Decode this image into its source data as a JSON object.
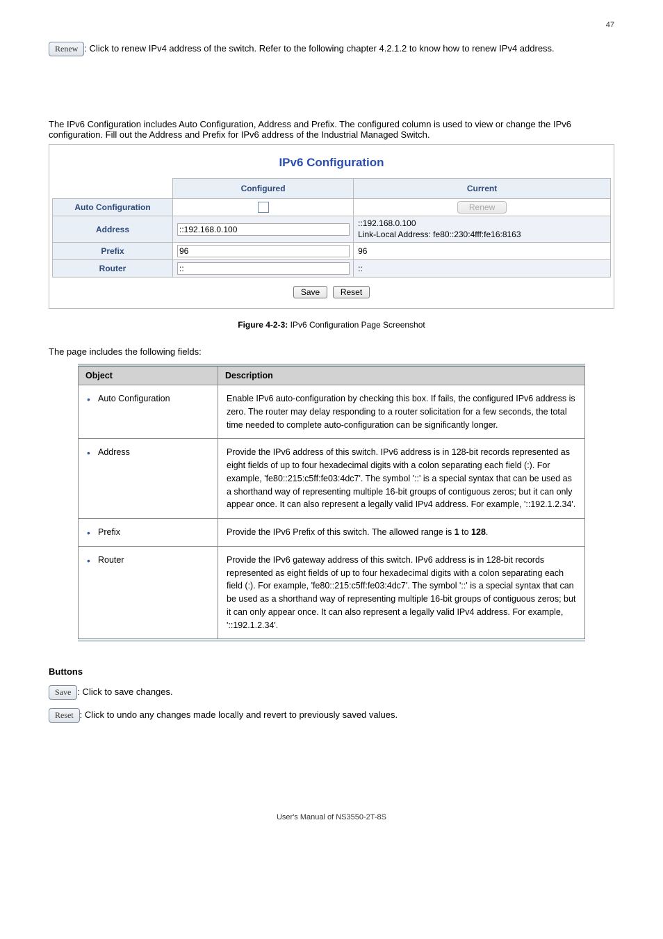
{
  "header": {
    "page_no": "47"
  },
  "intro": {
    "renew_label": "Renew",
    "renew_desc": ": Click to renew IPv4 address of the switch. Refer to the following chapter 4.2.1.2 to know how to renew IPv4 address."
  },
  "ipv6": {
    "title": "IPv6 Configuration",
    "lead": "The IPv6 Configuration includes Auto Configuration, Address and Prefix. The configured column is used to view or change the IPv6 configuration. Fill out the Address and Prefix for IPv6 address of the Industrial Managed Switch.",
    "cols": {
      "configured": "Configured",
      "current": "Current"
    },
    "rows": {
      "autoconf": {
        "label": "Auto Configuration",
        "configured_checked": false,
        "current_renew": "Renew"
      },
      "address": {
        "label": "Address",
        "configured": "::192.168.0.100",
        "current_line1": "::192.168.0.100",
        "current_line2": "Link-Local Address: fe80::230:4fff:fe16:8163"
      },
      "prefix": {
        "label": "Prefix",
        "configured": "96",
        "current": "96"
      },
      "router": {
        "label": "Router",
        "configured": "::",
        "current": "::"
      }
    },
    "buttons": {
      "save": "Save",
      "reset": "Reset"
    }
  },
  "figure": {
    "caption_strong": "Figure 4-2-3:",
    "caption_rest": " IPv6 Configuration Page Screenshot"
  },
  "desc": {
    "intro": "The page includes the following fields:",
    "headers": {
      "object": "Object",
      "description": "Description"
    },
    "rows": [
      {
        "object": "Auto Configuration",
        "desc": "Enable IPv6 auto-configuration by checking this box. If fails, the configured IPv6 address is zero. The router may delay responding to a router solicitation for a few seconds, the total time needed to complete auto-configuration can be significantly longer."
      },
      {
        "object": "Address",
        "desc": "Provide the IPv6 address of this switch. IPv6 address is in 128-bit records represented as eight fields of up to four hexadecimal digits with a colon separating each field (:). For example, 'fe80::215:c5ff:fe03:4dc7'. The symbol '::' is a special syntax that can be used as a shorthand way of representing multiple 16-bit groups of contiguous zeros; but it can only appear once. It can also represent a legally valid IPv4 address. For example, '::192.1.2.34'."
      },
      {
        "object": "Prefix",
        "desc_pre": "Provide the IPv6 Prefix of this switch. The allowed range is ",
        "desc_b1": "1",
        "desc_mid": " to ",
        "desc_b2": "128",
        "desc_post": "."
      },
      {
        "object": "Router",
        "desc": "Provide the IPv6 gateway address of this switch. IPv6 address is in 128-bit records represented as eight fields of up to four hexadecimal digits with a colon separating each field (:). For example, 'fe80::215:c5ff:fe03:4dc7'. The symbol '::' is a special syntax that can be used as a shorthand way of representing multiple 16-bit groups of contiguous zeros; but it can only appear once. It can also represent a legally valid IPv4 address. For example, '::192.1.2.34'."
      }
    ]
  },
  "buttons_section": {
    "title": "Buttons",
    "save": {
      "label": "Save",
      "desc": ": Click to save changes."
    },
    "reset": {
      "label": "Reset",
      "desc": ": Click to undo any changes made locally and revert to previously saved values."
    }
  },
  "footer": {
    "text": "User's Manual of NS3550-2T-8S"
  }
}
